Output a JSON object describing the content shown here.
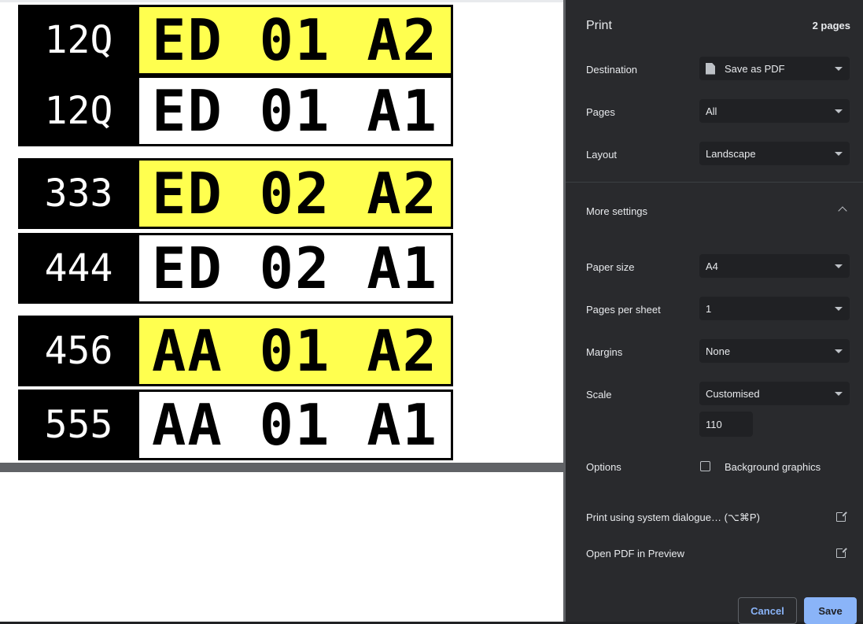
{
  "preview": {
    "labels": [
      {
        "number": "12Q",
        "code": [
          "ED",
          "01",
          "A2"
        ],
        "highlight": "yellow"
      },
      {
        "number": "12Q",
        "code": [
          "ED",
          "01",
          "A1"
        ],
        "highlight": "white"
      },
      {
        "number": "333",
        "code": [
          "ED",
          "02",
          "A2"
        ],
        "highlight": "yellow"
      },
      {
        "number": "444",
        "code": [
          "ED",
          "02",
          "A1"
        ],
        "highlight": "white"
      },
      {
        "number": "456",
        "code": [
          "AA",
          "01",
          "A2"
        ],
        "highlight": "yellow"
      },
      {
        "number": "555",
        "code": [
          "AA",
          "01",
          "A1"
        ],
        "highlight": "white"
      }
    ]
  },
  "panel": {
    "title": "Print",
    "page_count": "2 pages",
    "destination": {
      "label": "Destination",
      "value": "Save as PDF",
      "icon": "pdf-file-icon"
    },
    "pages": {
      "label": "Pages",
      "value": "All"
    },
    "layout": {
      "label": "Layout",
      "value": "Landscape"
    },
    "more_settings": {
      "label": "More settings",
      "icon": "chevron-up-icon"
    },
    "paper_size": {
      "label": "Paper size",
      "value": "A4"
    },
    "pages_per_sheet": {
      "label": "Pages per sheet",
      "value": "1"
    },
    "margins": {
      "label": "Margins",
      "value": "None"
    },
    "scale": {
      "label": "Scale",
      "value": "Customised",
      "custom_value": "110"
    },
    "options": {
      "label": "Options",
      "background_graphics": "Background graphics",
      "checked": false
    },
    "system_dialog": {
      "label": "Print using system dialogue… (⌥⌘P)",
      "icon": "open-external-icon"
    },
    "open_preview": {
      "label": "Open PDF in Preview",
      "icon": "open-external-icon"
    },
    "cancel_label": "Cancel",
    "save_label": "Save"
  },
  "colors": {
    "label_yellow": "#ffff4f",
    "panel_bg": "#292a2d",
    "accent": "#8ab4f8"
  }
}
